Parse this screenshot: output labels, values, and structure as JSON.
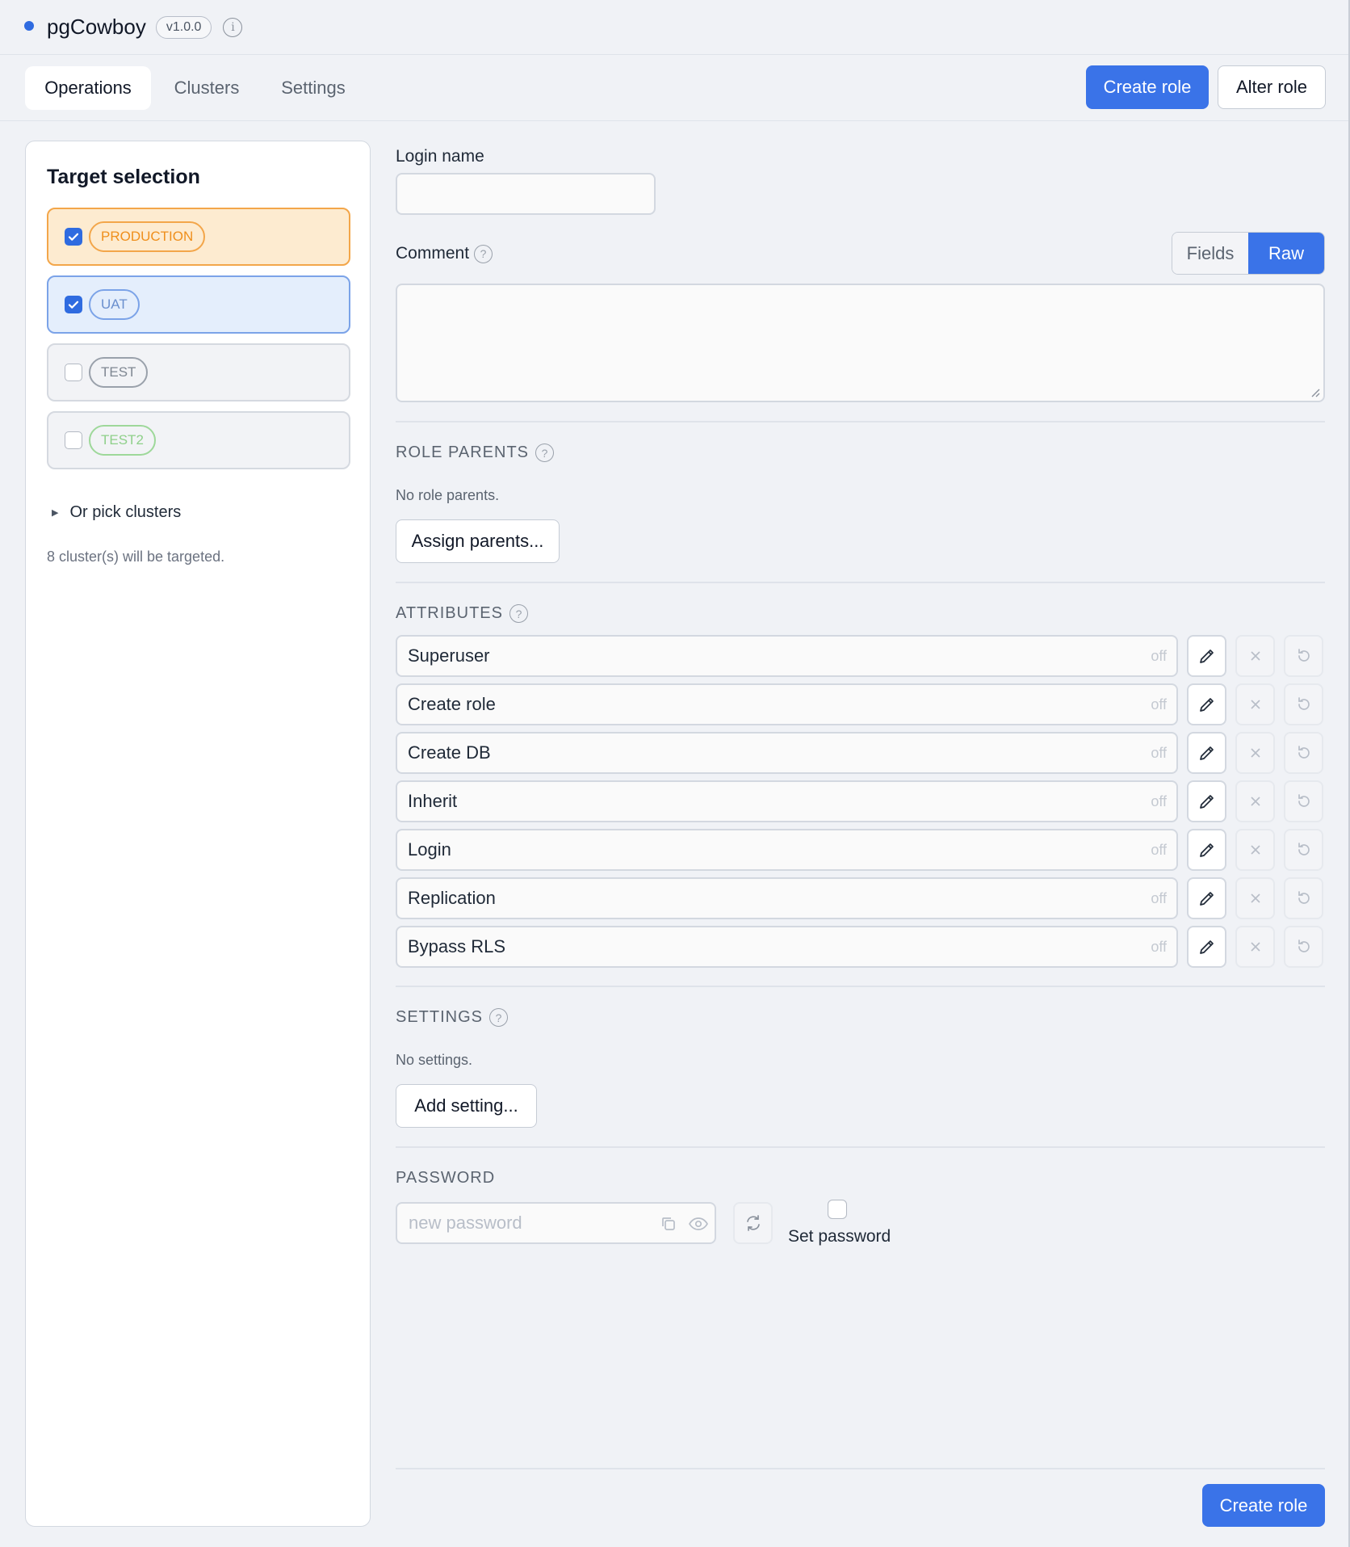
{
  "app": {
    "title": "pgCowboy",
    "version": "v1.0.0",
    "status_color": "#2f6be0"
  },
  "nav": {
    "tabs": [
      {
        "label": "Operations",
        "active": true
      },
      {
        "label": "Clusters",
        "active": false
      },
      {
        "label": "Settings",
        "active": false
      }
    ],
    "create_role_label": "Create role",
    "alter_role_label": "Alter role"
  },
  "target": {
    "title": "Target selection",
    "environments": [
      {
        "label": "PRODUCTION",
        "checked": true
      },
      {
        "label": "UAT",
        "checked": true
      },
      {
        "label": "TEST",
        "checked": false
      },
      {
        "label": "TEST2",
        "checked": false
      }
    ],
    "pick_clusters_label": "Or pick clusters",
    "targeted_note": "8 cluster(s) will be targeted."
  },
  "form": {
    "login_name_label": "Login name",
    "login_name_value": "",
    "comment_label": "Comment",
    "comment_value": "",
    "mode_fields": "Fields",
    "mode_raw": "Raw",
    "active_mode": "Raw",
    "role_parents": {
      "header": "ROLE PARENTS",
      "empty_text": "No role parents.",
      "button": "Assign parents..."
    },
    "attributes": {
      "header": "ATTRIBUTES",
      "items": [
        {
          "label": "Superuser",
          "value": "off"
        },
        {
          "label": "Create role",
          "value": "off"
        },
        {
          "label": "Create DB",
          "value": "off"
        },
        {
          "label": "Inherit",
          "value": "off"
        },
        {
          "label": "Login",
          "value": "off"
        },
        {
          "label": "Replication",
          "value": "off"
        },
        {
          "label": "Bypass RLS",
          "value": "off"
        }
      ]
    },
    "settings": {
      "header": "SETTINGS",
      "empty_text": "No settings.",
      "button": "Add setting..."
    },
    "password": {
      "header": "PASSWORD",
      "placeholder": "new password",
      "set_password_label": "Set password",
      "set_password_checked": false
    },
    "submit_label": "Create role"
  },
  "colors": {
    "accent": "#3a73e8",
    "production": "#ef8f1c",
    "uat": "#6a8fce",
    "test": "#7f8792",
    "test2": "#8fd08a"
  }
}
